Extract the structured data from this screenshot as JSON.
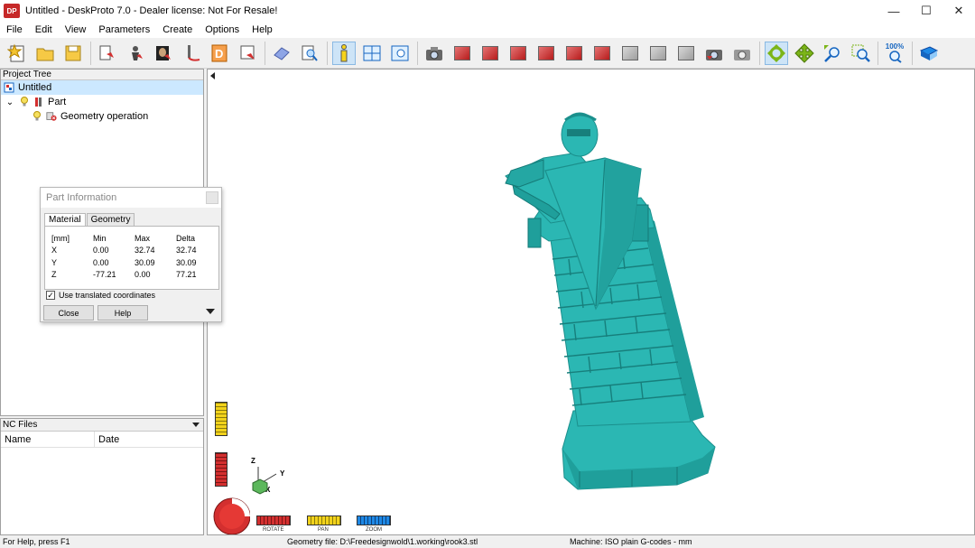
{
  "window": {
    "title": "Untitled - DeskProto 7.0 - Dealer license: Not For Resale!",
    "icon_label": "DP",
    "minimize": "—",
    "maximize": "☐",
    "close": "✕"
  },
  "menu": [
    "File",
    "Edit",
    "View",
    "Parameters",
    "Create",
    "Options",
    "Help"
  ],
  "toolbar": {
    "zoom_percent": "100%"
  },
  "project_tree": {
    "header": "Project Tree",
    "root": "Untitled",
    "expander": "⌄",
    "part": "Part",
    "operation": "Geometry operation"
  },
  "part_info": {
    "title": "Part Information",
    "tabs": [
      "Material",
      "Geometry"
    ],
    "columns": [
      "[mm]",
      "Min",
      "Max",
      "Delta"
    ],
    "rows": [
      {
        "axis": "X",
        "min": "0.00",
        "max": "32.74",
        "delta": "32.74"
      },
      {
        "axis": "Y",
        "min": "0.00",
        "max": "30.09",
        "delta": "30.09"
      },
      {
        "axis": "Z",
        "min": "-77.21",
        "max": "0.00",
        "delta": "77.21"
      }
    ],
    "checkbox_label": "Use translated coordinates",
    "checkbox_mark": "✓",
    "close_label": "Close",
    "help_label": "Help"
  },
  "nc_files": {
    "header": "NC Files",
    "columns": [
      "Name",
      "Date"
    ]
  },
  "viewport": {
    "axis_x": "X",
    "axis_y": "Y",
    "axis_z": "Z",
    "wheel_rotate": "ROTATE",
    "wheel_pan": "PAN",
    "wheel_zoom": "ZOOM"
  },
  "colors": {
    "model": "#2bb7b3",
    "model_shade": "#1b8f8c",
    "rotate_red": "#d32f2f",
    "pan_yellow": "#f2d21b",
    "zoom_blue": "#1e88e5"
  },
  "status": {
    "help": "For Help, press F1",
    "geometry": "Geometry file: D:\\Freedesignwold\\1.working\\rook3.stl",
    "machine": "Machine: ISO plain G-codes - mm"
  }
}
